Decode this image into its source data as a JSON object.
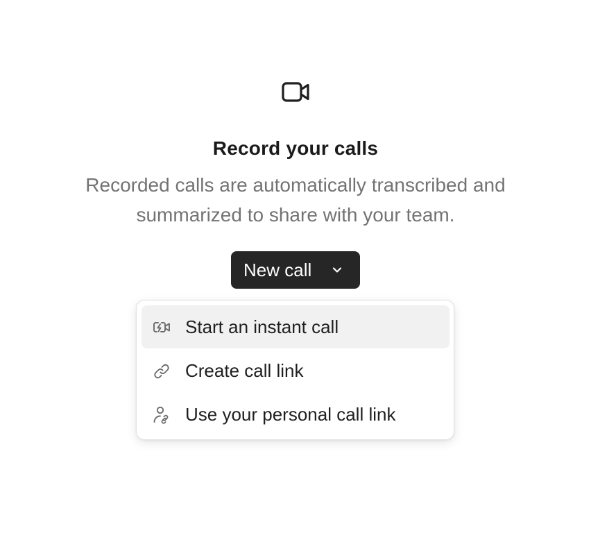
{
  "empty_state": {
    "icon": "video-camera-icon",
    "title": "Record your calls",
    "description": "Recorded calls are automatically transcribed and summarized to share with your team."
  },
  "new_call_button": {
    "label": "New call",
    "icon": "chevron-down-icon"
  },
  "dropdown_menu": {
    "items": [
      {
        "label": "Start an instant call",
        "icon": "instant-call-icon",
        "highlighted": true
      },
      {
        "label": "Create call link",
        "icon": "link-icon",
        "highlighted": false
      },
      {
        "label": "Use your personal call link",
        "icon": "personal-link-icon",
        "highlighted": false
      }
    ]
  },
  "colors": {
    "button_background": "#262626",
    "highlight_background": "#f1f1f1",
    "muted_text": "#737373"
  }
}
